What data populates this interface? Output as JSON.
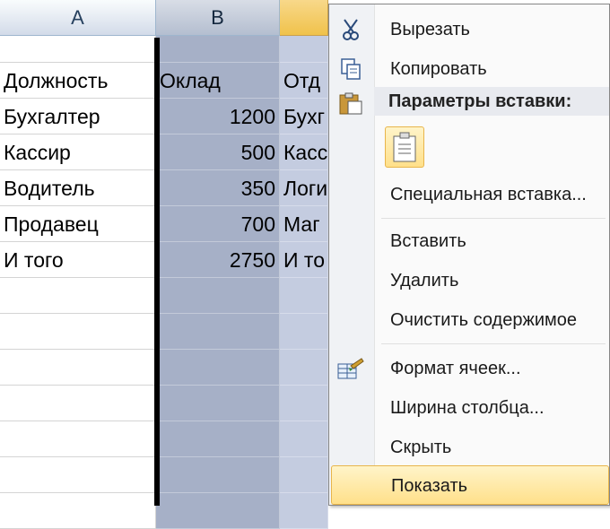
{
  "columns": {
    "a": "A",
    "b": "B"
  },
  "rows": [
    {
      "a": "Должность",
      "b": "Оклад",
      "c": "Отд"
    },
    {
      "a": "Бухгалтер",
      "b": "1200",
      "c": "Бухг"
    },
    {
      "a": "Кассир",
      "b": "500",
      "c": "Касс"
    },
    {
      "a": "Водитель",
      "b": "350",
      "c": "Логи"
    },
    {
      "a": "Продавец",
      "b": "700",
      "c": "Маг"
    },
    {
      "a": "И того",
      "b": "2750",
      "c": "И то"
    }
  ],
  "menu": {
    "cut": "Вырезать",
    "copy": "Копировать",
    "paste_options": "Параметры вставки:",
    "paste_special": "Специальная вставка...",
    "insert": "Вставить",
    "delete": "Удалить",
    "clear": "Очистить содержимое",
    "format": "Формат ячеек...",
    "width": "Ширина столбца...",
    "hide": "Скрыть",
    "show": "Показать"
  },
  "icons": [
    "scissors-icon",
    "copy-icon",
    "paste-icon",
    "paste-option-icon",
    "format-cells-icon"
  ],
  "colors": {
    "selected_column": "#a6b0c7",
    "header_selected": "#f0c24b",
    "menu_highlight": "#ffe08a"
  }
}
